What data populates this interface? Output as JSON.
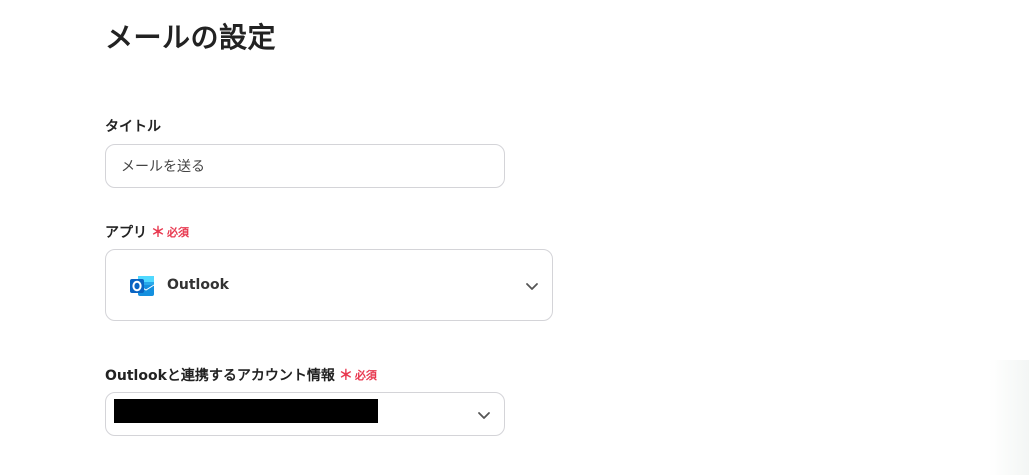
{
  "page": {
    "title": "メールの設定"
  },
  "title_field": {
    "label": "タイトル",
    "value": "メールを送る"
  },
  "app_field": {
    "label": "アプリ",
    "required_mark": "＊",
    "required_label": "必須",
    "selected": {
      "name": "Outlook",
      "icon": "outlook-icon"
    }
  },
  "account_field": {
    "label": "Outlookと連携するアカウント情報",
    "required_mark": "＊",
    "required_label": "必須"
  },
  "colors": {
    "required": "#e8384f",
    "border": "#d4d4d8",
    "outlook_blue": "#0a64c2"
  }
}
